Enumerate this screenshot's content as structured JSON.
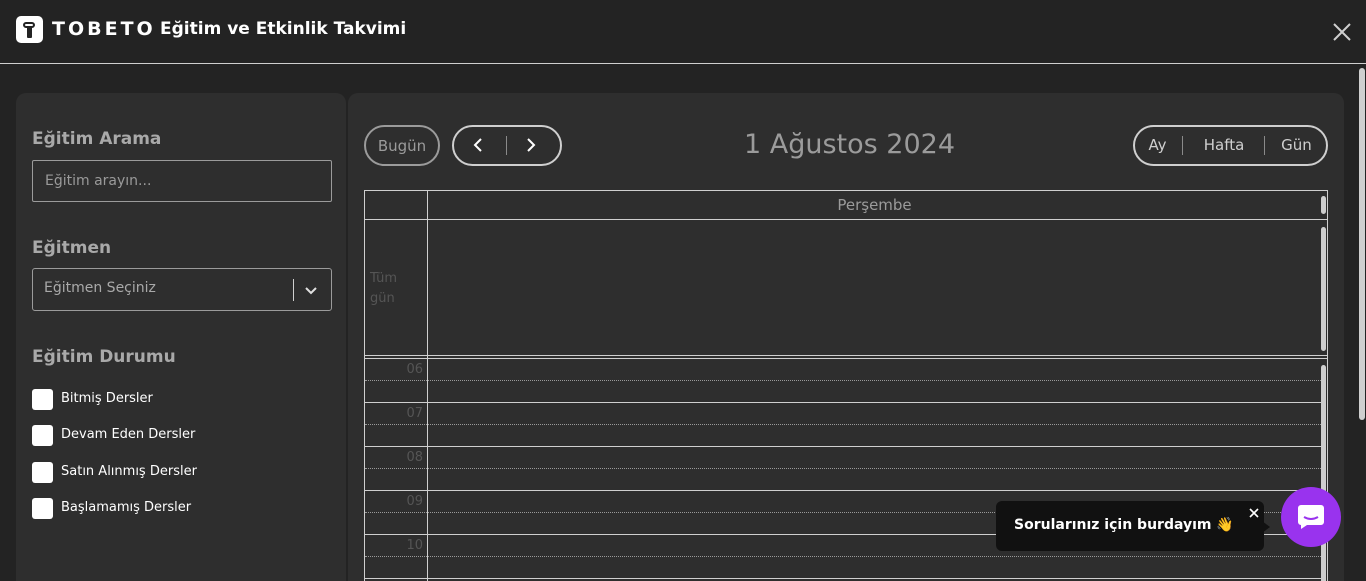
{
  "header": {
    "brand": "TOBETO",
    "title": "Eğitim ve Etkinlik Takvimi"
  },
  "sidebar": {
    "search_label": "Eğitim Arama",
    "search_placeholder": "Eğitim arayın...",
    "instructor_label": "Eğitmen",
    "instructor_placeholder": "Eğitmen Seçiniz",
    "status_label": "Eğitim Durumu",
    "status_options": [
      {
        "label": "Bitmiş Dersler",
        "checked": false
      },
      {
        "label": "Devam Eden Dersler",
        "checked": false
      },
      {
        "label": "Satın Alınmış Dersler",
        "checked": false
      },
      {
        "label": "Başlamamış Dersler",
        "checked": false
      }
    ]
  },
  "calendar": {
    "today_label": "Bugün",
    "date_title": "1 Ağustos 2024",
    "views": [
      "Ay",
      "Hafta",
      "Gün"
    ],
    "day_header": "Perşembe",
    "allday_label": "Tüm gün",
    "hours": [
      "06",
      "07",
      "08",
      "09",
      "10"
    ]
  },
  "chat": {
    "tooltip": "Sorularınız için burdayım 👋"
  },
  "colors": {
    "background": "#232323",
    "panel": "#2e2e2e",
    "accent_chat": "#9933ee"
  }
}
